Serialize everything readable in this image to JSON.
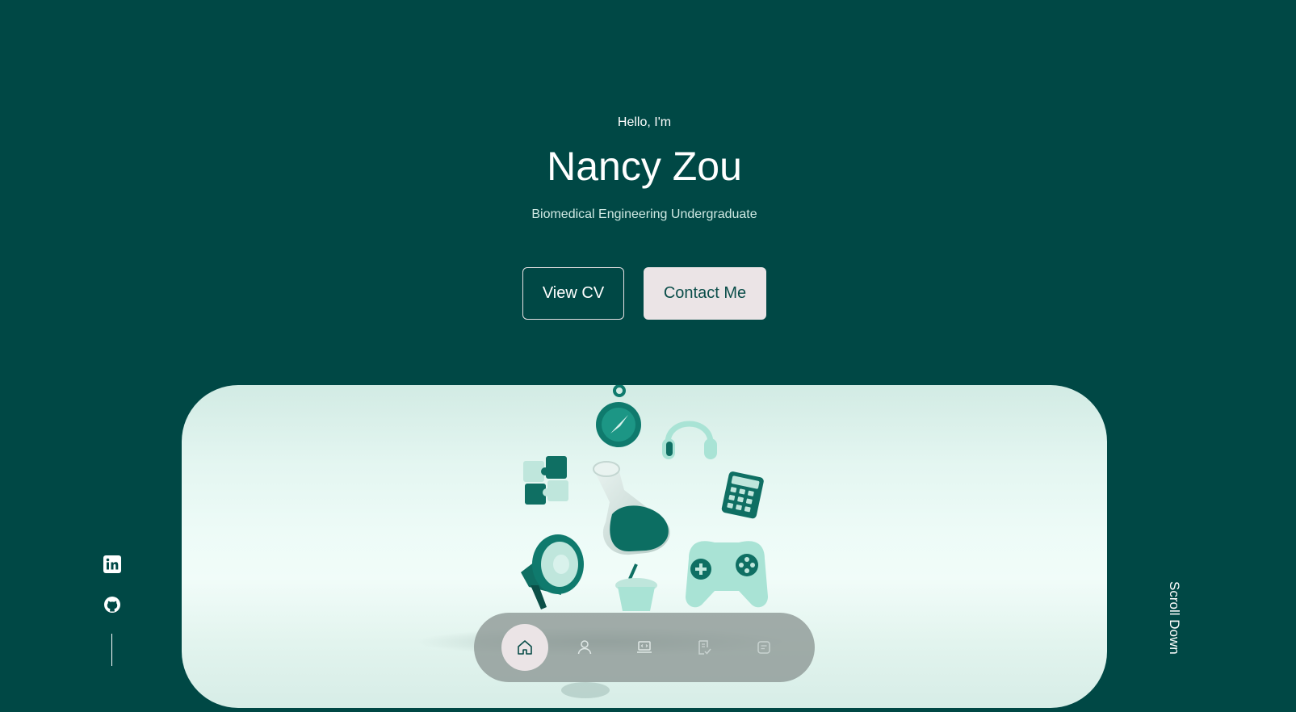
{
  "hero": {
    "greeting": "Hello, I'm",
    "name": "Nancy Zou",
    "subtitle": "Biomedical Engineering Undergraduate"
  },
  "buttons": {
    "view_cv": "View CV",
    "contact": "Contact Me"
  },
  "nav": {
    "items": [
      {
        "icon": "home-icon",
        "active": true
      },
      {
        "icon": "user-icon",
        "active": false
      },
      {
        "icon": "laptop-code-icon",
        "active": false
      },
      {
        "icon": "document-check-icon",
        "active": false
      },
      {
        "icon": "message-icon",
        "active": false
      }
    ]
  },
  "social": {
    "items": [
      {
        "icon": "linkedin-icon"
      },
      {
        "icon": "github-icon"
      }
    ]
  },
  "scroll_label": "Scroll Down",
  "colors": {
    "background": "#004845",
    "accent": "#0a4d49",
    "button_light": "#ebe4e6",
    "card_light": "#edfbf7"
  }
}
